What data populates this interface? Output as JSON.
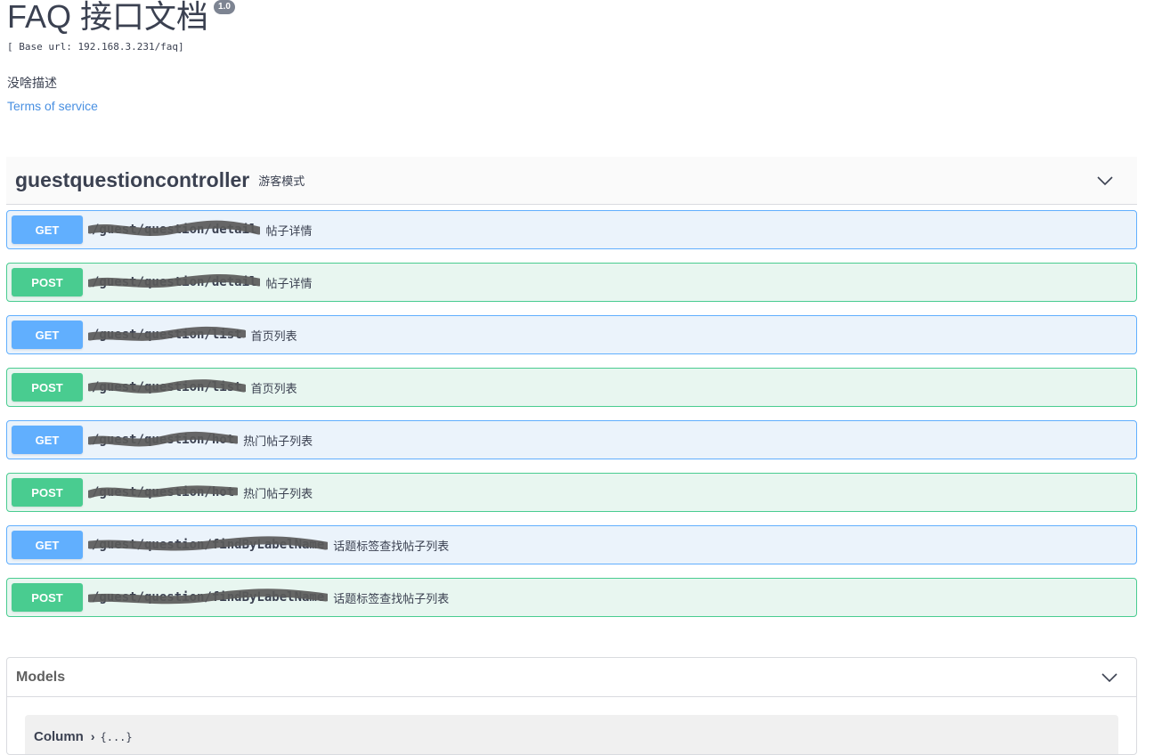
{
  "info": {
    "title": "FAQ 接口文档",
    "version": "1.0",
    "base_url": "[ Base url: 192.168.3.231/faq]",
    "description": "没啥描述",
    "terms_link": "Terms of service"
  },
  "tag": {
    "name": "guestquestioncontroller",
    "description": "游客模式",
    "expand_icon": "chevron-down-icon"
  },
  "operations": [
    {
      "method": "GET",
      "path": "/guest/question/detail",
      "summary": "帖子详情",
      "redacted": true
    },
    {
      "method": "POST",
      "path": "/guest/question/detail",
      "summary": "帖子详情",
      "redacted": true
    },
    {
      "method": "GET",
      "path": "/guest/question/list",
      "summary": "首页列表",
      "redacted": true
    },
    {
      "method": "POST",
      "path": "/guest/question/list",
      "summary": "首页列表",
      "redacted": true
    },
    {
      "method": "GET",
      "path": "/guest/question/hot",
      "summary": "热门帖子列表",
      "redacted": true
    },
    {
      "method": "POST",
      "path": "/guest/question/hot",
      "summary": "热门帖子列表",
      "redacted": true
    },
    {
      "method": "GET",
      "path": "/guest/question/findByLabelName",
      "summary": "话题标签查找帖子列表",
      "redacted": true
    },
    {
      "method": "POST",
      "path": "/guest/question/findByLabelName",
      "summary": "话题标签查找帖子列表",
      "redacted": true
    }
  ],
  "models": {
    "title": "Models",
    "expand_icon": "chevron-down-icon",
    "items": [
      {
        "name": "Column",
        "arrow": "›",
        "preview": "{...}"
      }
    ]
  },
  "colors": {
    "get": "#61affe",
    "post": "#49cc90",
    "link": "#4990e2",
    "text": "#3b4151"
  }
}
